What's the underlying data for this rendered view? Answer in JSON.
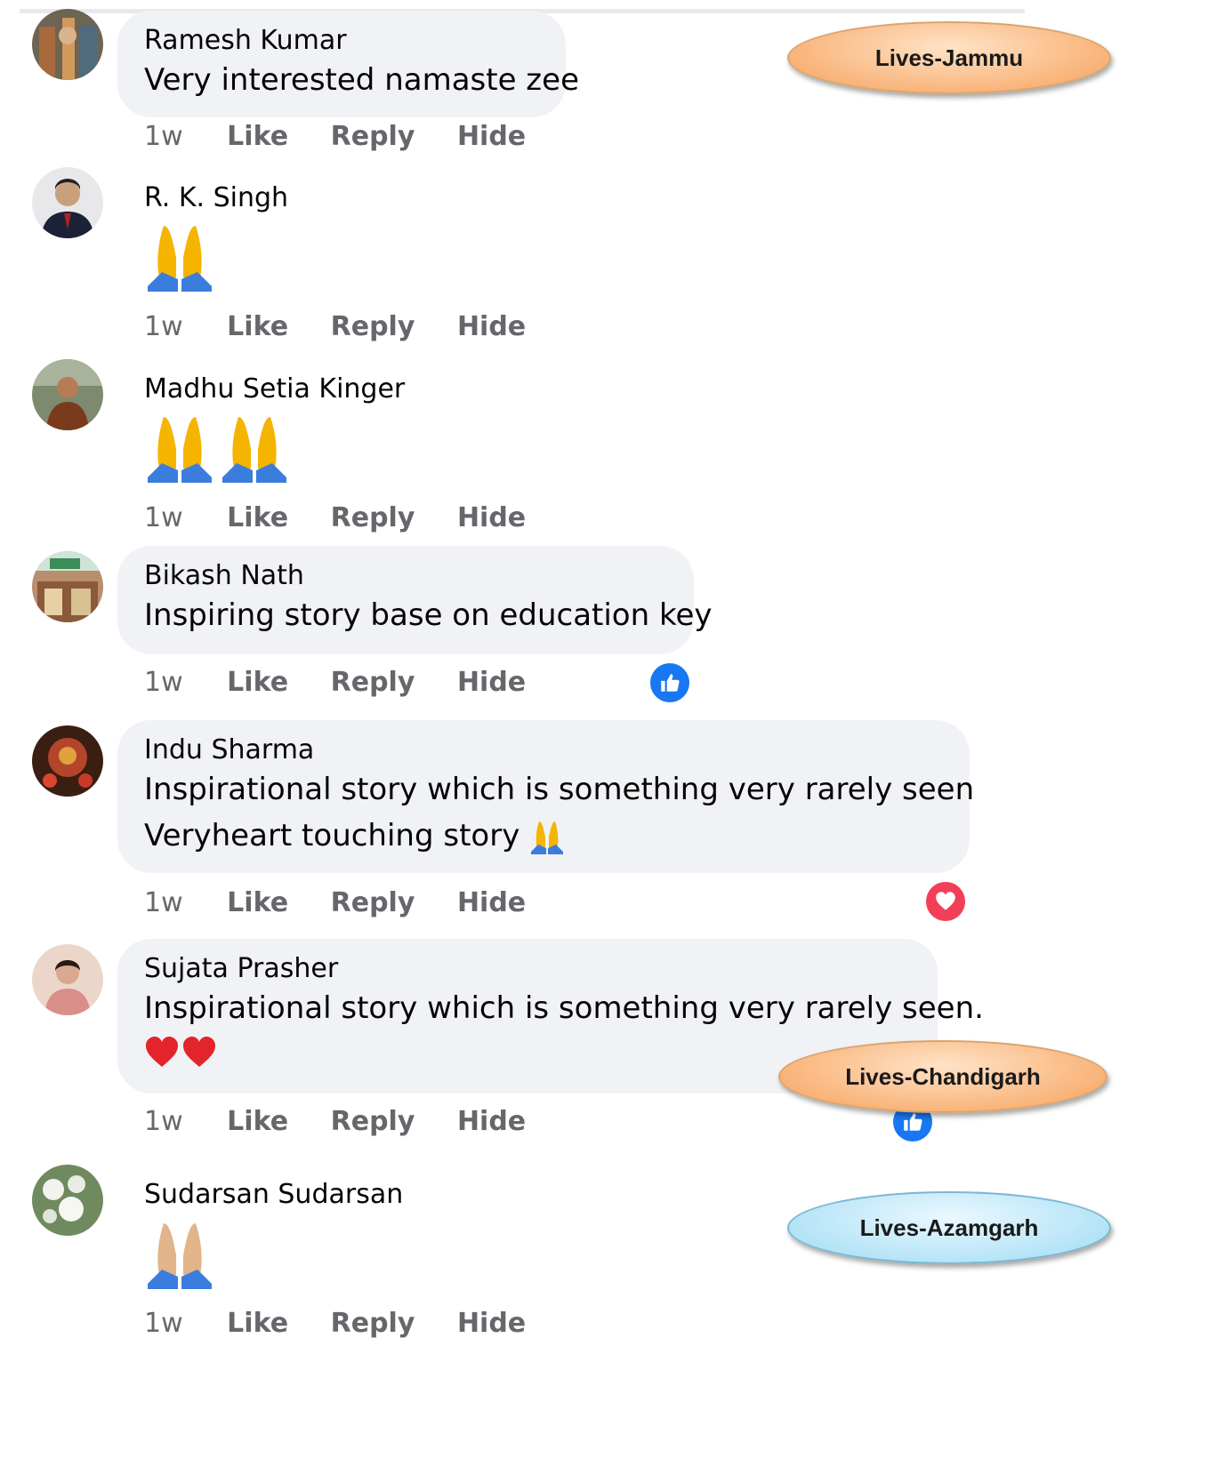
{
  "actions": {
    "time": "1w",
    "like": "Like",
    "reply": "Reply",
    "hide": "Hide"
  },
  "comments": [
    {
      "author": "Ramesh Kumar",
      "text": "Very interested namaste zee"
    },
    {
      "author": "R. K. Singh",
      "emoji": "🙏"
    },
    {
      "author": "Madhu Setia Kinger",
      "emoji": "🙏🙏"
    },
    {
      "author": "Bikash Nath",
      "text": "Inspiring story base on education key",
      "reaction": "like"
    },
    {
      "author": "Indu Sharma",
      "text_line1": "Inspirational story which is something very rarely seen",
      "text_line2": "Veryheart touching story",
      "reaction": "love"
    },
    {
      "author": "Sujata Prasher",
      "text_line1": "Inspirational story which is something very rarely seen.",
      "emoji": "❤❤",
      "reaction": "like"
    },
    {
      "author": "Sudarsan Sudarsan",
      "emoji": "🙏"
    }
  ],
  "location_tags": [
    "Lives-Jammu",
    "Lives-Chandigarh",
    "Lives-Azamgarh"
  ],
  "colors": {
    "bubble": "#f0f2f5",
    "like_blue": "#1877f2",
    "love_red": "#f33e58",
    "muted_text": "#65676b"
  }
}
